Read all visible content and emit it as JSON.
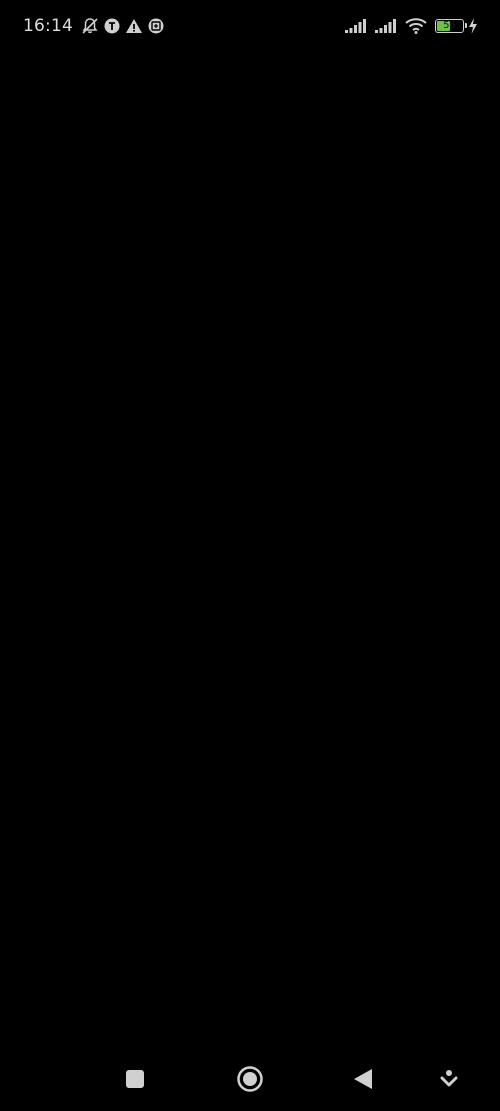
{
  "status_bar": {
    "time": "16:14",
    "left_icons": [
      "bell-off-icon",
      "notification-t-icon",
      "warning-icon",
      "screenshot-icon"
    ],
    "right_icons": [
      "signal-sim1-icon",
      "signal-sim2-icon",
      "wifi-icon",
      "battery-icon",
      "charging-icon"
    ],
    "battery_level": "56",
    "battery_fraction": 0.56,
    "battery_color": "#6cc24a"
  },
  "main": {
    "background_color": "#000000"
  },
  "nav_bar": {
    "buttons": [
      "recent-apps-button",
      "home-button",
      "back-button",
      "hide-navbar-button"
    ]
  }
}
